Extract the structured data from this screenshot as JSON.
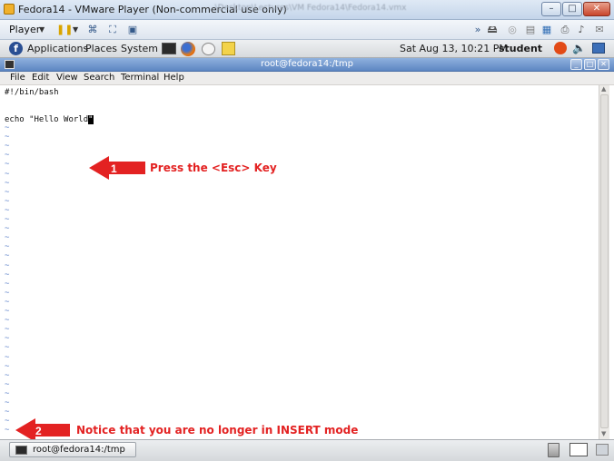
{
  "vm": {
    "title": "Fedora14 - VMware Player (Non-commercial use only)",
    "title_path": "...\\Desktop\\Lectures\\VM Fedora14\\Fedora14.vmx",
    "player_menu": "Player",
    "window_controls": {
      "minimize": "–",
      "maximize": "□",
      "close": "✕"
    }
  },
  "gnome_panel": {
    "applications": "Applications",
    "places": "Places",
    "system": "System",
    "clock": "Sat Aug 13, 10:21 PM",
    "user": "student"
  },
  "terminal": {
    "title": "root@fedora14:/tmp",
    "menu": [
      "File",
      "Edit",
      "View",
      "Search",
      "Terminal",
      "Help"
    ],
    "lines": {
      "line1": "#!/bin/bash",
      "line3_text": "echo \"Hello World",
      "line3_cursor": "\""
    },
    "tilde": "~"
  },
  "annotations": [
    {
      "number": "1",
      "text": "Press the <Esc> Key"
    },
    {
      "number": "2",
      "text": "Notice that you are no longer in INSERT mode"
    }
  ],
  "taskbar": {
    "item_label": "root@fedora14:/tmp"
  },
  "colors": {
    "annotation": "#e32222",
    "terminal_title": "#5d86c2"
  }
}
